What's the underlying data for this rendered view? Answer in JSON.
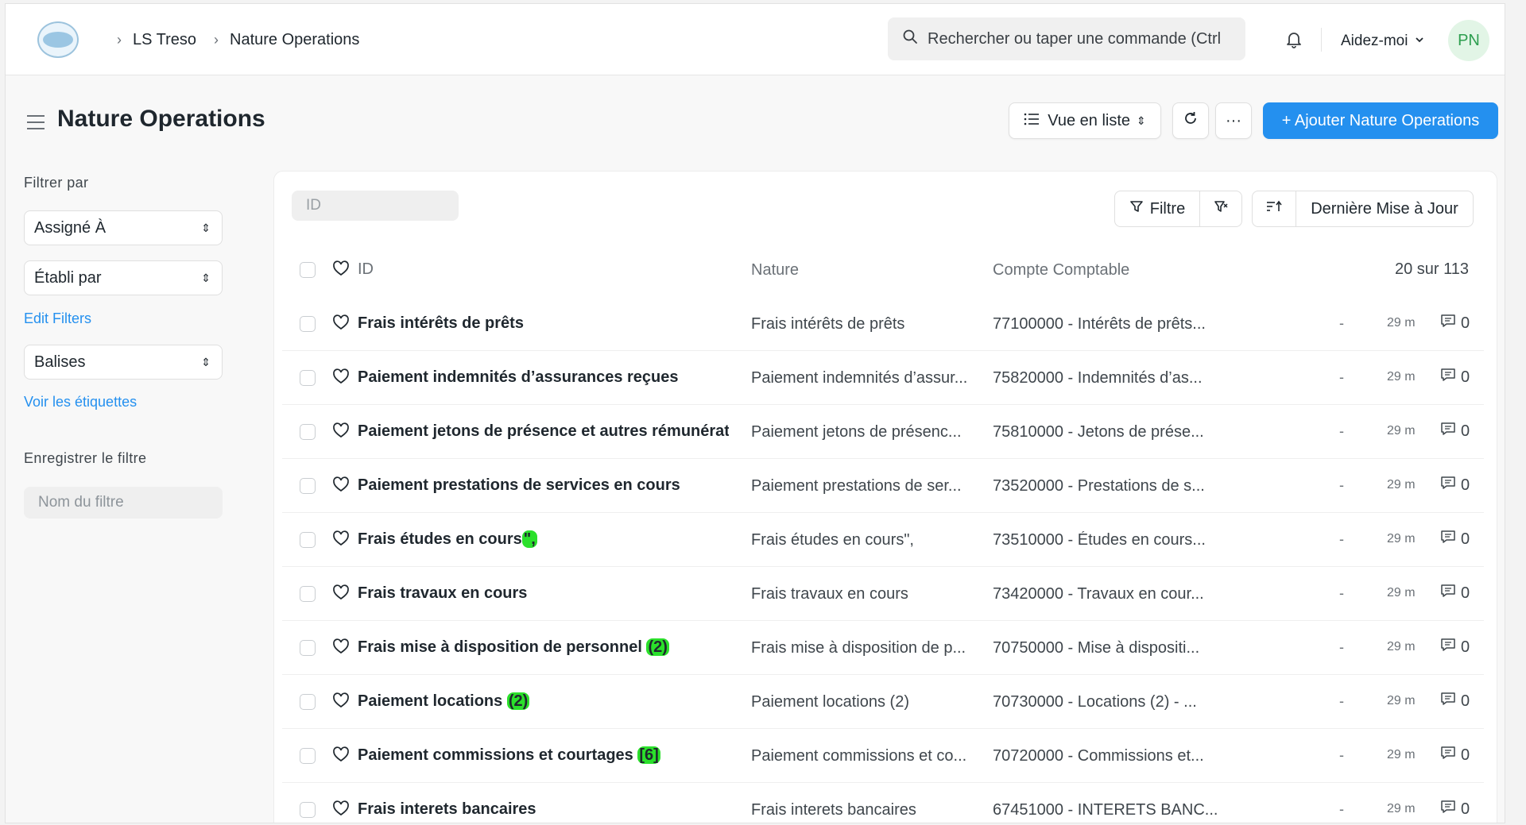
{
  "navbar": {
    "breadcrumbs": [
      "LS Treso",
      "Nature Operations"
    ],
    "search_placeholder": "Rechercher ou taper une commande (Ctrl",
    "help_label": "Aidez-moi",
    "avatar_initials": "PN"
  },
  "page": {
    "title": "Nature Operations",
    "view_label": "Vue en liste",
    "more_label": "···",
    "add_label": "+ Ajouter Nature Operations"
  },
  "sidebar": {
    "filter_by_label": "Filtrer par",
    "assigned_to": "Assigné À",
    "created_by": "Établi par",
    "edit_filters": "Edit Filters",
    "tags": "Balises",
    "show_tags": "Voir les étiquettes",
    "save_filter_label": "Enregistrer le filtre",
    "filter_name_placeholder": "Nom du filtre"
  },
  "list": {
    "id_placeholder": "ID",
    "filter_label": "Filtre",
    "sort_label": "Dernière Mise à Jour",
    "headers": {
      "id": "ID",
      "nature": "Nature",
      "compte": "Compte Comptable"
    },
    "count": "20 sur 113",
    "rows": [
      {
        "id": "Frais intérêts de prêts",
        "id_mark": "",
        "nature": "Frais intérêts de prêts",
        "compte": "77100000 - Intérêts de prêts...",
        "dash": "-",
        "time": "29 m",
        "comments": "0"
      },
      {
        "id": "Paiement indemnités d’assurances reçues",
        "id_mark": "",
        "nature": "Paiement indemnités d’assur...",
        "compte": "75820000 - Indemnités d’as...",
        "dash": "-",
        "time": "29 m",
        "comments": "0"
      },
      {
        "id": "Paiement jetons de présence et autres rémunérat",
        "id_mark": "",
        "nature": "Paiement jetons de présenc...",
        "compte": "75810000 - Jetons de prése...",
        "dash": "-",
        "time": "29 m",
        "comments": "0"
      },
      {
        "id": "Paiement prestations de services en cours",
        "id_mark": "",
        "nature": "Paiement prestations de ser...",
        "compte": "73520000 - Prestations de s...",
        "dash": "-",
        "time": "29 m",
        "comments": "0"
      },
      {
        "id": "Frais études en cours",
        "id_mark": "\",",
        "nature": "Frais études en cours\",",
        "compte": "73510000 - Études en cours...",
        "dash": "-",
        "time": "29 m",
        "comments": "0"
      },
      {
        "id": "Frais travaux en cours",
        "id_mark": "",
        "nature": "Frais travaux en cours",
        "compte": "73420000 - Travaux en cour...",
        "dash": "-",
        "time": "29 m",
        "comments": "0"
      },
      {
        "id": "Frais mise à disposition de personnel ",
        "id_mark": "(2)",
        "nature": "Frais mise à disposition de p...",
        "compte": "70750000 - Mise à dispositi...",
        "dash": "-",
        "time": "29 m",
        "comments": "0"
      },
      {
        "id": "Paiement locations ",
        "id_mark": "(2)",
        "nature": "Paiement locations (2)",
        "compte": "70730000 - Locations (2) - ...",
        "dash": "-",
        "time": "29 m",
        "comments": "0"
      },
      {
        "id": "Paiement commissions et courtages ",
        "id_mark": "[6]",
        "nature": "Paiement commissions et co...",
        "compte": "70720000 - Commissions et...",
        "dash": "-",
        "time": "29 m",
        "comments": "0"
      },
      {
        "id": "Frais interets bancaires",
        "id_mark": "",
        "nature": "Frais interets bancaires",
        "compte": "67451000 - INTERETS BANC...",
        "dash": "-",
        "time": "29 m",
        "comments": "0"
      }
    ]
  }
}
